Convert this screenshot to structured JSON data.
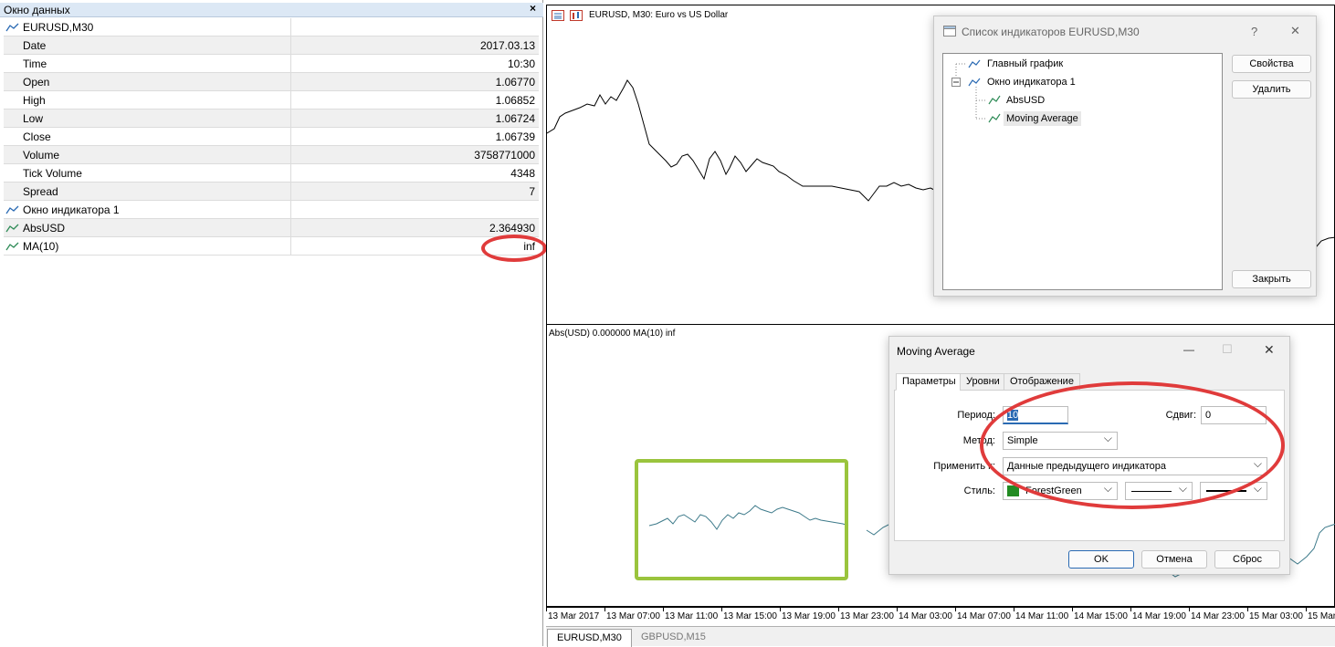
{
  "data_window": {
    "title": "Окно данных",
    "close": "×",
    "rows": [
      {
        "label": "EURUSD,M30",
        "value": "",
        "icon": "chart-line-icon",
        "shade": false
      },
      {
        "label": "Date",
        "value": "2017.03.13",
        "icon": "",
        "shade": true
      },
      {
        "label": "Time",
        "value": "10:30",
        "icon": "",
        "shade": false
      },
      {
        "label": "Open",
        "value": "1.06770",
        "icon": "",
        "shade": true
      },
      {
        "label": "High",
        "value": "1.06852",
        "icon": "",
        "shade": false
      },
      {
        "label": "Low",
        "value": "1.06724",
        "icon": "",
        "shade": true
      },
      {
        "label": "Close",
        "value": "1.06739",
        "icon": "",
        "shade": false
      },
      {
        "label": "Volume",
        "value": "3758771000",
        "icon": "",
        "shade": true
      },
      {
        "label": "Tick Volume",
        "value": "4348",
        "icon": "",
        "shade": false
      },
      {
        "label": "Spread",
        "value": "7",
        "icon": "",
        "shade": true
      },
      {
        "label": "Окно индикатора 1",
        "value": "",
        "icon": "chart-line-icon",
        "shade": false
      },
      {
        "label": "AbsUSD",
        "value": "2.364930",
        "icon": "indicator-icon",
        "shade": true
      },
      {
        "label": "MA(10)",
        "value": "inf",
        "icon": "indicator-icon",
        "shade": false
      }
    ]
  },
  "chart": {
    "title": "EURUSD, M30:  Euro vs US Dollar",
    "subwindow_title": "Abs(USD) 0.000000 MA(10) inf",
    "time_ticks": [
      "13 Mar 2017",
      "13 Mar 07:00",
      "13 Mar 11:00",
      "13 Mar 15:00",
      "13 Mar 19:00",
      "13 Mar 23:00",
      "14 Mar 03:00",
      "14 Mar 07:00",
      "14 Mar 11:00",
      "14 Mar 15:00",
      "14 Mar 19:00",
      "14 Mar 23:00",
      "15 Mar 03:00",
      "15 Mar"
    ],
    "tabs": [
      "EURUSD,M30",
      "GBPUSD,M15"
    ],
    "line_color": "#000000",
    "ma_color": "#3d7a8a"
  },
  "indicator_dialog": {
    "title": "Список индикаторов EURUSD,M30",
    "help": "?",
    "close": "✕",
    "tree": [
      "Главный график",
      "Окно индикатора 1",
      "AbsUSD",
      "Moving Average"
    ],
    "buttons": {
      "properties": "Свойства",
      "delete": "Удалить",
      "close": "Закрыть"
    }
  },
  "ma_dialog": {
    "title": "Moving Average",
    "minimize": "—",
    "maximize": "☐",
    "close": "✕",
    "tabs": [
      "Параметры",
      "Уровни",
      "Отображение"
    ],
    "labels": {
      "period": "Период:",
      "shift": "Сдвиг:",
      "method": "Метод:",
      "apply": "Применить к:",
      "style": "Стиль:"
    },
    "values": {
      "period": "10",
      "shift": "0",
      "method": "Simple",
      "apply": "Данные предыдущего индикатора",
      "color": "ForestGreen"
    },
    "color_swatch": "#228b22",
    "buttons": {
      "ok": "OK",
      "cancel": "Отмена",
      "reset": "Сброс"
    }
  },
  "annotations": {
    "ellipse_color": "#e03b3b",
    "box_color": "#9ac43d"
  }
}
